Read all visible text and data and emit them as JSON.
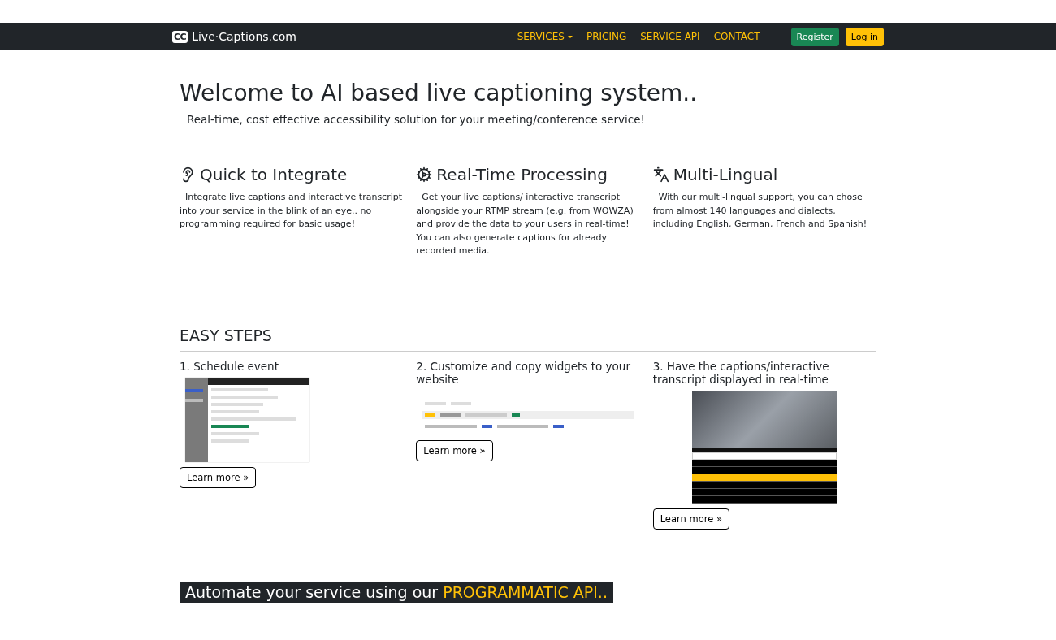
{
  "navbar": {
    "logo_mark": "CC",
    "brand": "Live·Captions.com",
    "links": [
      {
        "label": "SERVICES",
        "dropdown": true
      },
      {
        "label": "PRICING",
        "dropdown": false
      },
      {
        "label": "SERVICE API",
        "dropdown": false
      },
      {
        "label": "CONTACT",
        "dropdown": false
      }
    ],
    "buttons": [
      {
        "label": "Register",
        "kind": "register"
      },
      {
        "label": "Log in",
        "kind": "login"
      }
    ]
  },
  "hero": {
    "title": "Welcome to AI based live captioning system..",
    "subtitle": "Real-time, cost effective accessibility solution for your meeting/conference service!"
  },
  "features": [
    {
      "kind": "ear",
      "title": "Quick to Integrate",
      "text": "Integrate live captions and interactive transcript into your service in the blink of an eye.. no programming required for basic usage!"
    },
    {
      "kind": "gears",
      "title": "Real-Time Processing",
      "text": "Get your live captions/ interactive transcript alongside your RTMP stream (e.g. from WOWZA) and provide the data to your users in real-time! You can also generate captions for already recorded media."
    },
    {
      "kind": "language",
      "title": "Multi-Lingual",
      "text": "With our multi-lingual support, you can chose from almost 140 languages and dialects, including English, German, French and Spanish!"
    }
  ],
  "steps_section": {
    "heading": "EASY STEPS",
    "steps": [
      {
        "title": "1. Schedule event",
        "kind": "form",
        "button": "Learn more »"
      },
      {
        "title": "2. Customize and copy widgets to your website",
        "kind": "table",
        "button": "Learn more »"
      },
      {
        "title": "3. Have the captions/interactive transcript displayed in real-time",
        "kind": "video",
        "button": "Learn more »"
      }
    ]
  },
  "api_banner": {
    "text": "Automate your service using our",
    "highlight": "PROGRAMMATIC API.."
  }
}
